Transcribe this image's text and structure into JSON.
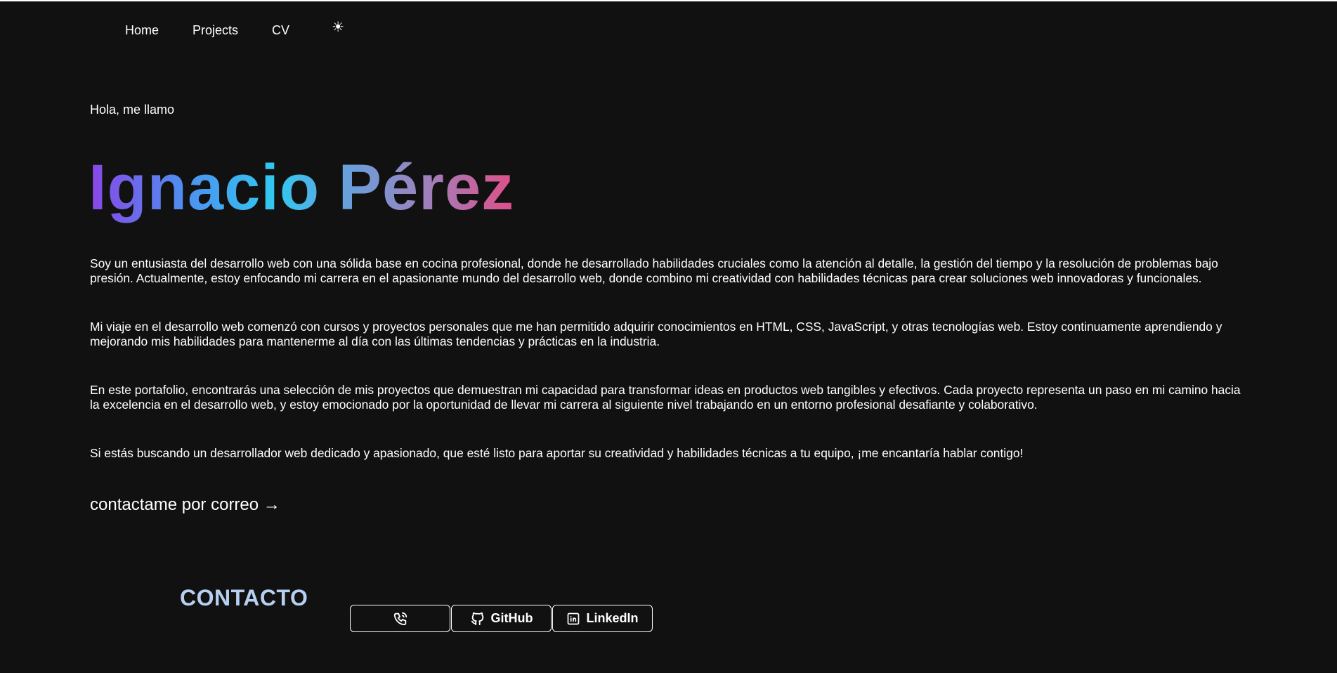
{
  "nav": {
    "items": [
      "Home",
      "Projects",
      "CV"
    ],
    "theme_toggle": "☀"
  },
  "hero": {
    "greeting": "Hola, me llamo",
    "name": "Ignacio Pérez"
  },
  "about": {
    "paragraphs": [
      "Soy un entusiasta del desarrollo web con una sólida base en cocina profesional, donde he desarrollado habilidades cruciales como la atención al detalle, la gestión del tiempo y la resolución de problemas bajo presión. Actualmente, estoy enfocando mi carrera en el apasionante mundo del desarrollo web, donde combino mi creatividad con habilidades técnicas para crear soluciones web innovadoras y funcionales.",
      "Mi viaje en el desarrollo web comenzó con cursos y proyectos personales que me han permitido adquirir conocimientos en HTML, CSS, JavaScript, y otras tecnologías web. Estoy continuamente aprendiendo y mejorando mis habilidades para mantenerme al día con las últimas tendencias y prácticas en la industria.",
      "En este portafolio, encontrarás una selección de mis proyectos que demuestran mi capacidad para transformar ideas en productos web tangibles y efectivos. Cada proyecto representa un paso en mi camino hacia la excelencia en el desarrollo web, y estoy emocionado por la oportunidad de llevar mi carrera al siguiente nivel trabajando en un entorno profesional desafiante y colaborativo.",
      "Si estás buscando un desarrollador web dedicado y apasionado, que esté listo para aportar su creatividad y habilidades técnicas a tu equipo, ¡me encantaría hablar contigo!"
    ],
    "mail_link": "contactame por correo →"
  },
  "contact": {
    "title": "CONTACTO",
    "buttons": [
      {
        "icon": "phone-icon",
        "label": ""
      },
      {
        "icon": "github-icon",
        "label": "GitHub"
      },
      {
        "icon": "linkedin-icon",
        "label": "LinkedIn"
      }
    ]
  },
  "colors": {
    "background": "#111111",
    "text": "#ffffff",
    "contact_title": "#b7d0f2",
    "name_gradient": [
      "#8a45e6",
      "#31c9ef",
      "#e04f89"
    ]
  }
}
